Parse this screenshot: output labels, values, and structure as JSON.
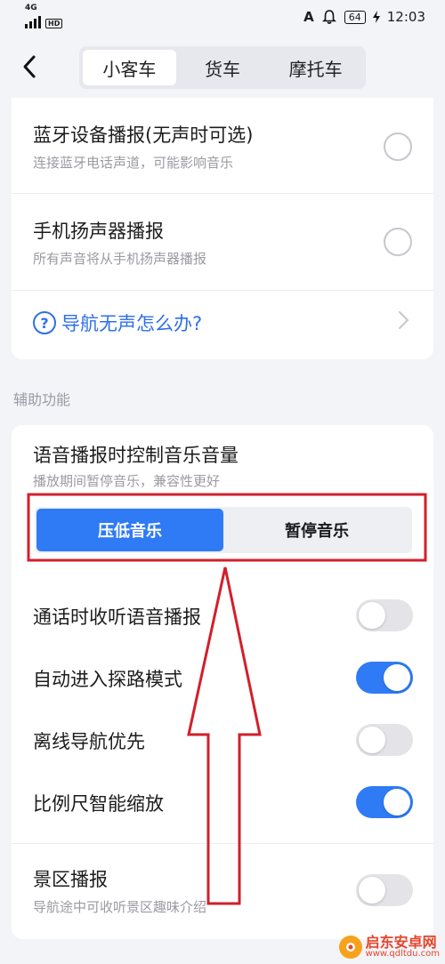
{
  "status_bar": {
    "network": "4G",
    "hd": "HD",
    "carrier_icon": "A",
    "battery": "64",
    "time": "12:03"
  },
  "header": {
    "tabs": [
      {
        "label": "小客车",
        "active": true
      },
      {
        "label": "货车",
        "active": false
      },
      {
        "label": "摩托车",
        "active": false
      }
    ]
  },
  "broadcast": {
    "options": [
      {
        "title": "蓝牙设备播报(无声时可选)",
        "subtitle": "连接蓝牙电话声道，可能影响音乐",
        "selected": false
      },
      {
        "title": "手机扬声器播报",
        "subtitle": "所有声音将从手机扬声器播报",
        "selected": false
      }
    ],
    "help_link": "导航无声怎么办?"
  },
  "assist": {
    "section_label": "辅助功能",
    "music_control": {
      "title": "语音播报时控制音乐音量",
      "subtitle": "播放期间暂停音乐，兼容性更好",
      "segments": [
        "压低音乐",
        "暂停音乐"
      ],
      "selected_index": 0
    },
    "toggles": [
      {
        "label": "通话时收听语音播报",
        "on": false
      },
      {
        "label": "自动进入探路模式",
        "on": true
      },
      {
        "label": "离线导航优先",
        "on": false
      },
      {
        "label": "比例尺智能缩放",
        "on": true
      }
    ],
    "scenic": {
      "title": "景区播报",
      "subtitle": "导航途中可收听景区趣味介绍",
      "on": false
    }
  },
  "colors": {
    "accent": "#2f7bf5",
    "link": "#2f6fe8",
    "annotation": "#d21f2b"
  },
  "watermark": {
    "name": "启东安卓网",
    "url": "www.qdltdu.com"
  }
}
